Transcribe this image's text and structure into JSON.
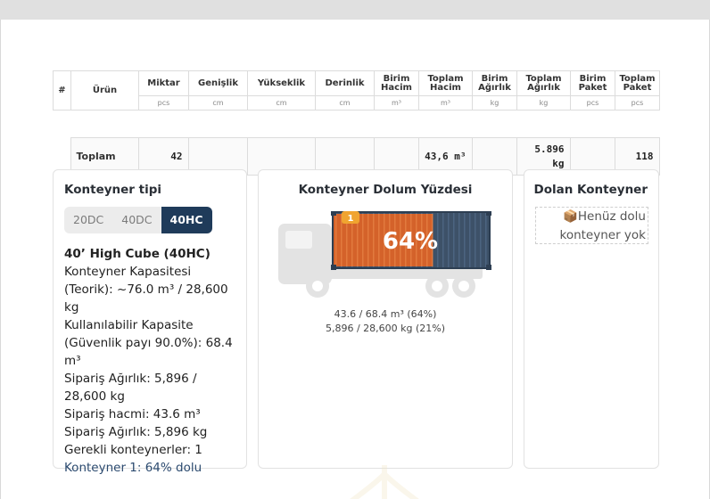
{
  "table": {
    "columns": [
      {
        "label": "#",
        "unit": ""
      },
      {
        "label": "Ürün",
        "unit": ""
      },
      {
        "label": "Miktar",
        "unit": "pcs"
      },
      {
        "label": "Genişlik",
        "unit": "cm"
      },
      {
        "label": "Yükseklik",
        "unit": "cm"
      },
      {
        "label": "Derinlik",
        "unit": "cm"
      },
      {
        "label": "Birim Hacim",
        "unit": "m³"
      },
      {
        "label": "Toplam Hacim",
        "unit": "m³"
      },
      {
        "label": "Birim Ağırlık",
        "unit": "kg"
      },
      {
        "label": "Toplam Ağırlık",
        "unit": "kg"
      },
      {
        "label": "Birim Paket",
        "unit": "pcs"
      },
      {
        "label": "Toplam Paket",
        "unit": "pcs"
      }
    ],
    "total_row": {
      "label": "Toplam",
      "quantity": "42",
      "total_volume": "43,6 m³",
      "total_weight_line1": "5.896",
      "total_weight_line2": "kg",
      "total_packages": "118"
    }
  },
  "container_type": {
    "title": "Konteyner tipi",
    "options": [
      "20DC",
      "40DC",
      "40HC"
    ],
    "selected": "40HC",
    "details": {
      "heading": "40’ High Cube (40HC)",
      "line1": "Konteyner Kapasitesi (Teorik): ~76.0 m³ / 28,600 kg",
      "line2": "Kullanılabilir Kapasite (Güvenlik payı 90.0%): 68.4 m³",
      "line3": "Sipariş Ağırlık: 5,896 / 28,600 kg",
      "line4": "Sipariş hacmi: 43.6 m³",
      "line5": "Sipariş Ağırlık: 5,896 kg",
      "line6": "Gerekli konteynerler: 1",
      "line7": "Konteyner 1: 64% dolu"
    }
  },
  "fill": {
    "title": "Konteyner Dolum Yüzdesi",
    "badge": "1",
    "percent_label": "64%",
    "fill_fraction": 0.64,
    "volume_text": "43.6 / 68.4 m³ (64%)",
    "weight_text": "5,896 / 28,600 kg (21%)",
    "colors": {
      "fill": "#d4622a",
      "container": "#3d5168",
      "truck": "#e3e3e3",
      "badge": "#f0a430"
    }
  },
  "full_containers": {
    "title": "Dolan Konteyner",
    "empty_icon": "📦",
    "empty_text": "Henüz dolu konteyner yok"
  }
}
